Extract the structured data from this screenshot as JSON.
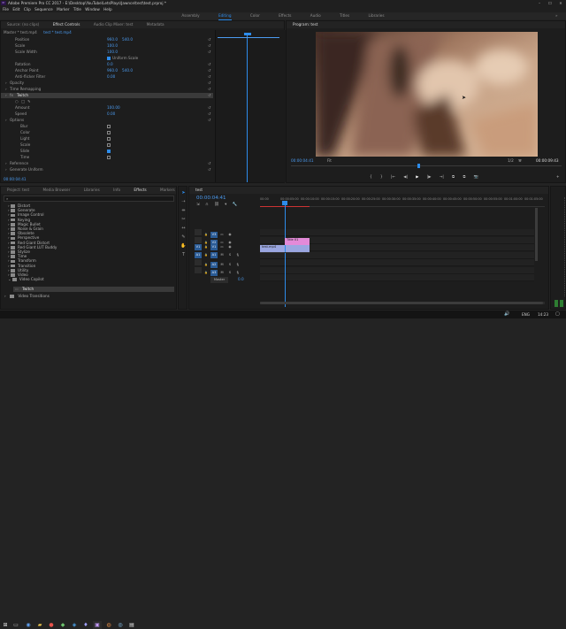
{
  "window": {
    "title": "Adobe Premiere Pro CC 2017 - E:\\Desktop\\YouTube\\LetsPlays\\Jawnce\\test\\test.prproj *",
    "controls": [
      "–",
      "☐",
      "✕"
    ]
  },
  "menu": [
    "File",
    "Edit",
    "Clip",
    "Sequence",
    "Marker",
    "Title",
    "Window",
    "Help"
  ],
  "workspaces": {
    "items": [
      "Assembly",
      "Editing",
      "Color",
      "Effects",
      "Audio",
      "Titles",
      "Libraries"
    ],
    "active": "Editing"
  },
  "effect_controls": {
    "tabs": [
      "Source: (no clips)",
      "Effect Controls",
      "Audio Clip Mixer: test",
      "Metadata"
    ],
    "active_tab": "Effect Controls",
    "master_label": "Master * test.mp4",
    "clip_label": "test * test.mp4",
    "rows": [
      {
        "label": "Position",
        "v1": "960.0",
        "v2": "540.0",
        "kind": "value"
      },
      {
        "label": "Scale",
        "v1": "100.0",
        "kind": "value"
      },
      {
        "label": "Scale Width",
        "v1": "100.0",
        "kind": "value"
      },
      {
        "label": "Uniform Scale",
        "kind": "checkbox",
        "checked": true
      },
      {
        "label": "Rotation",
        "v1": "0.0",
        "kind": "value"
      },
      {
        "label": "Anchor Point",
        "v1": "960.0",
        "v2": "540.0",
        "kind": "value"
      },
      {
        "label": "Anti-flicker Filter",
        "v1": "0.00",
        "kind": "value"
      },
      {
        "label": "Opacity",
        "kind": "group"
      },
      {
        "label": "Time Remapping",
        "kind": "group"
      },
      {
        "label": "Twitch",
        "kind": "selected"
      },
      {
        "label": "",
        "kind": "masks"
      },
      {
        "label": "Amount",
        "v1": "100.00",
        "kind": "value"
      },
      {
        "label": "Speed",
        "v1": "0.00",
        "kind": "value"
      },
      {
        "label": "Options",
        "kind": "group"
      },
      {
        "label": "Blur",
        "kind": "checkbox",
        "checked": false
      },
      {
        "label": "Color",
        "kind": "checkbox",
        "checked": false
      },
      {
        "label": "Light",
        "kind": "checkbox",
        "checked": false
      },
      {
        "label": "Scale",
        "kind": "checkbox",
        "checked": false
      },
      {
        "label": "Slide",
        "kind": "checkbox",
        "checked": true
      },
      {
        "label": "Time",
        "kind": "checkbox",
        "checked": false
      },
      {
        "label": "Reference",
        "kind": "group"
      },
      {
        "label": "Generate Uniform",
        "kind": "group"
      }
    ],
    "timecode": "00:00:04:41"
  },
  "program": {
    "tab": "Program: test",
    "timecode_left": "00:00:04:41",
    "fit": "Fit",
    "zoom": "1/2",
    "timecode_right": "00:00:09:43",
    "transport": [
      "{",
      "}",
      "|←",
      "◀|",
      "▶",
      "|▶",
      "→|",
      "⧉",
      "⧉",
      "📷"
    ]
  },
  "project": {
    "tabs": [
      "Project: test",
      "Media Browser",
      "Libraries",
      "Info",
      "Effects",
      "Markers"
    ],
    "active_tab": "Effects",
    "bins": [
      "Distort",
      "Generate",
      "Image Control",
      "Keying",
      "Magic Bullet",
      "Noise & Grain",
      "Obsolete",
      "Perspective",
      "Red Giant Distort",
      "Red Giant LUT Buddy",
      "Stylize",
      "Time",
      "Transform",
      "Transition",
      "Utility",
      "Video",
      "Video Copilot"
    ],
    "selected_effect": "Twitch",
    "last_item": "Video Transitions"
  },
  "timeline": {
    "tab": "test",
    "timecode": "00:00:04:41",
    "ruler": [
      "00:00",
      "00:00:05:00",
      "00:00:10:00",
      "00:00:15:00",
      "00:00:20:00",
      "00:00:25:00",
      "00:00:30:00",
      "00:00:35:00",
      "00:00:40:00",
      "00:00:45:00",
      "00:00:50:00",
      "00:00:55:00",
      "00:01:00:00",
      "00:01:05:00"
    ],
    "tracks": [
      {
        "name": "V3"
      },
      {
        "name": "V2"
      },
      {
        "name": "V1"
      },
      {
        "name": "A1"
      },
      {
        "name": "A2"
      },
      {
        "name": "A3"
      },
      {
        "name": "Master",
        "value": "0.0"
      }
    ],
    "clips": {
      "title_clip": "Title 01",
      "video_clip": "test.mp4"
    }
  },
  "taskbar": {
    "lang": "ENG",
    "time": "14:23"
  }
}
